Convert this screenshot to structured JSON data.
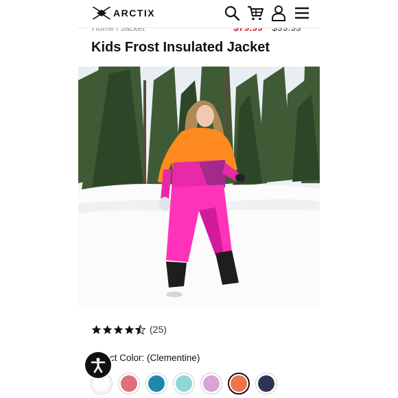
{
  "header": {
    "logo_text": "ARCTIX",
    "icons": [
      "search-icon",
      "cart-icon",
      "account-icon",
      "menu-icon"
    ]
  },
  "breadcrumb": {
    "text": "Home / Jacket"
  },
  "price": {
    "sale": "$79.99",
    "regular": "$99.99",
    "sale_color": "#d0242a"
  },
  "product": {
    "title": "Kids Frost Insulated Jacket",
    "image_alt": "Girl in orange and pink snow suit in a snowy forest"
  },
  "rating": {
    "stars": 4.5,
    "count": "(25)"
  },
  "color": {
    "label": "Select Color: (Clementine)",
    "selected": "Clementine",
    "swatches": [
      {
        "hex": "#ffffff"
      },
      {
        "hex": "#e0707a"
      },
      {
        "hex": "#1c8aa8"
      },
      {
        "hex": "#8fd6d6"
      },
      {
        "hex": "#d7a6d6"
      },
      {
        "hex": "#f0734a"
      },
      {
        "hex": "#2c3454"
      }
    ]
  },
  "accessibility": {
    "icon": "accessibility-icon"
  }
}
